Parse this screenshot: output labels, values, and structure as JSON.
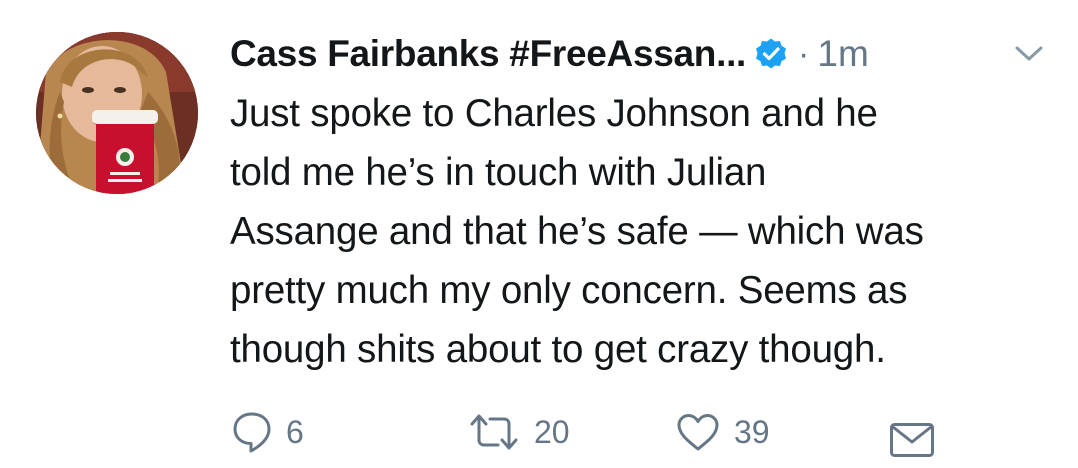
{
  "tweet": {
    "display_name": "Cass Fairbanks #FreeAssan...",
    "separator": "·",
    "timestamp": "1m",
    "lines": [
      "Just spoke to Charles Johnson and he",
      "told me he’s in touch with Julian",
      "Assange and that he’s safe — which was",
      "pretty much my only concern. Seems as",
      "though shits about to get crazy though."
    ],
    "reply_count": "6",
    "retweet_count": "20",
    "like_count": "39"
  },
  "colors": {
    "text": "#14171a",
    "secondary": "#657786",
    "verified_blue": "#1da1f2",
    "cup_red": "#c8102e"
  },
  "icons": {
    "verified": "verified-badge-icon",
    "caret": "chevron-down-icon",
    "reply": "reply-bubble-icon",
    "retweet": "retweet-icon",
    "like": "heart-icon",
    "dm": "envelope-icon"
  }
}
